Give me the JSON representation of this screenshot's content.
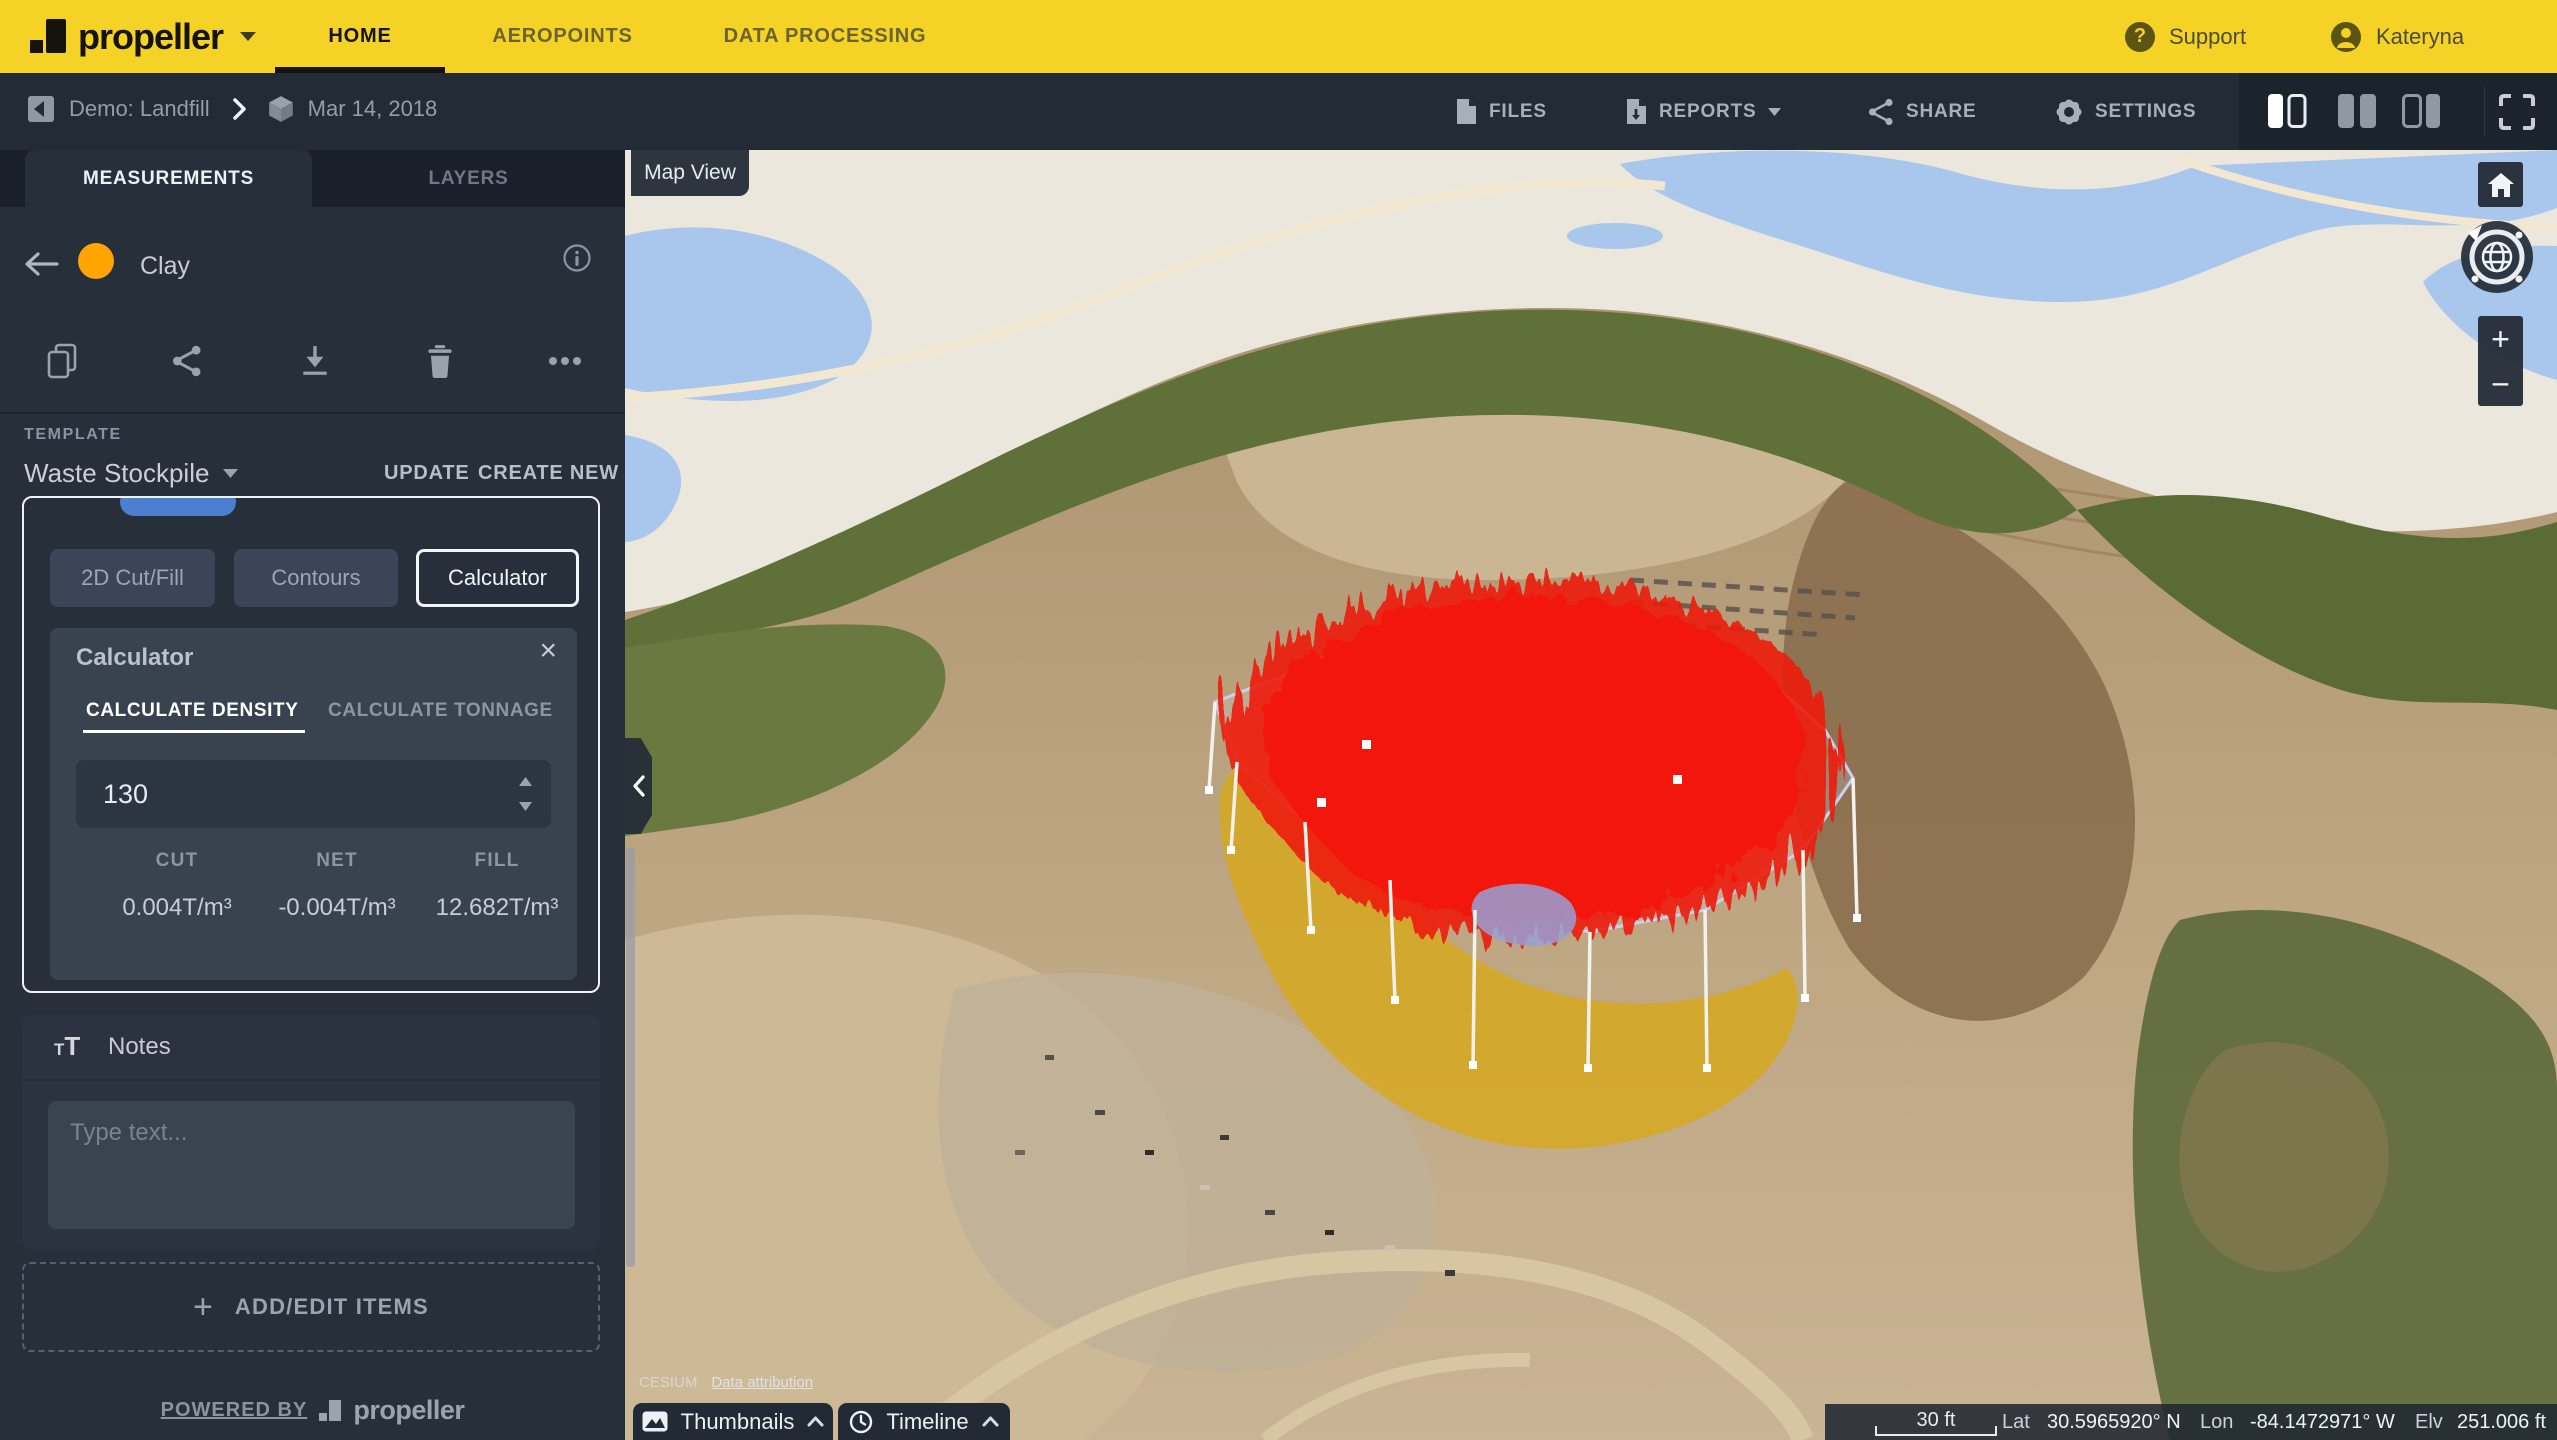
{
  "topnav": {
    "logo_text": "propeller",
    "tabs": [
      {
        "label": "HOME"
      },
      {
        "label": "AEROPOINTS"
      },
      {
        "label": "DATA PROCESSING"
      }
    ],
    "support_label": "Support",
    "user_name": "Kateryna"
  },
  "toolbar": {
    "site_name": "Demo: Landfill",
    "date_label": "Mar 14, 2018",
    "files_label": "FILES",
    "reports_label": "REPORTS",
    "share_label": "SHARE",
    "settings_label": "SETTINGS"
  },
  "sidebar": {
    "tab_measurements": "MEASUREMENTS",
    "tab_layers": "LAYERS",
    "measurement_name": "Clay",
    "template_label": "TEMPLATE",
    "template_value": "Waste Stockpile",
    "update_label": "UPDATE",
    "create_new_label": "CREATE NEW",
    "view_tabs": [
      {
        "label": "2D Cut/Fill"
      },
      {
        "label": "Contours"
      },
      {
        "label": "Calculator"
      }
    ],
    "calculator": {
      "title": "Calculator",
      "tab_density": "CALCULATE DENSITY",
      "tab_tonnage": "CALCULATE TONNAGE",
      "density_value": "130",
      "results": [
        {
          "label": "CUT",
          "value": "0.004T/m³"
        },
        {
          "label": "NET",
          "value": "-0.004T/m³"
        },
        {
          "label": "FILL",
          "value": "12.682T/m³"
        }
      ]
    },
    "notes_title": "Notes",
    "notes_placeholder": "Type text...",
    "add_edit_label": "ADD/EDIT ITEMS",
    "powered_by_label": "POWERED BY",
    "powered_brand": "propeller"
  },
  "map": {
    "view_label": "Map View",
    "attribution_brand": "CESIUM",
    "attribution_link": "Data attribution",
    "thumbnails_label": "Thumbnails",
    "timeline_label": "Timeline",
    "scale_label": "30 ft",
    "status": {
      "lat_label": "Lat",
      "lat_value": "30.5965920° N",
      "lon_label": "Lon",
      "lon_value": "-84.1472971° W",
      "elv_label": "Elv",
      "elv_value": "251.006 ft"
    }
  },
  "colors": {
    "brand_yellow": "#F5D226",
    "measurement_orange": "#FFA400",
    "volume_red": "#F21B0E",
    "base_yellow": "#D9A816",
    "selection_blue": "#4C7FD0"
  }
}
